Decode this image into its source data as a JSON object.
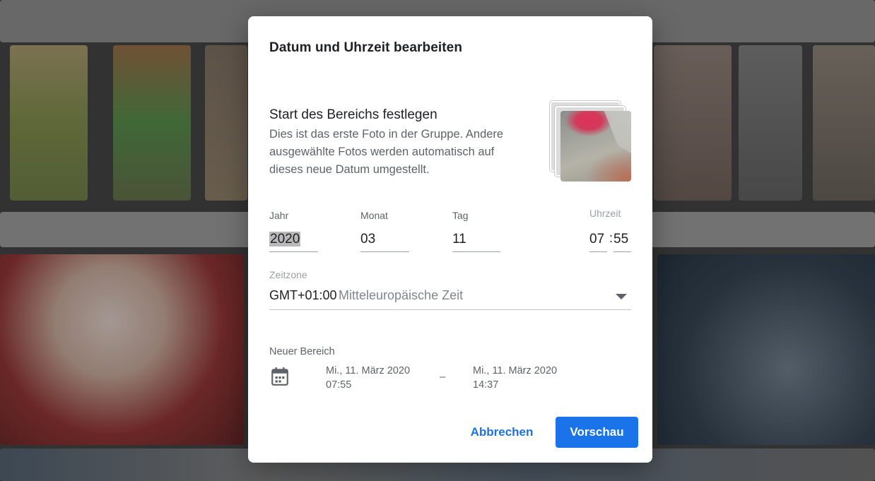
{
  "dialog": {
    "title": "Datum und Uhrzeit bearbeiten",
    "section_title": "Start des Bereichs festlegen",
    "section_description": "Dies ist das erste Foto in der Gruppe. Andere ausgewählte Fotos werden automatisch auf dieses neue Datum umgestellt.",
    "fields": {
      "year": {
        "label": "Jahr",
        "value": "2020"
      },
      "month": {
        "label": "Monat",
        "value": "03"
      },
      "day": {
        "label": "Tag",
        "value": "11"
      },
      "time": {
        "label": "Uhrzeit",
        "hour": "07",
        "separator": ":",
        "minute": "55"
      }
    },
    "timezone": {
      "label": "Zeitzone",
      "offset": "GMT+01:00",
      "name": "Mitteleuropäische Zeit"
    },
    "new_range": {
      "label": "Neuer Bereich",
      "start_date": "Mi., 11. März 2020",
      "start_time": "07:55",
      "separator": "–",
      "end_date": "Mi., 11. März 2020",
      "end_time": "14:37"
    },
    "buttons": {
      "cancel": "Abbrechen",
      "preview": "Vorschau"
    }
  },
  "icons": {
    "thumbnail": "photo-stack-thumbnail",
    "calendar": "calendar-icon",
    "dropdown": "dropdown-arrow-icon"
  },
  "colors": {
    "accent": "#1a73e8",
    "overlay": "#000000"
  }
}
